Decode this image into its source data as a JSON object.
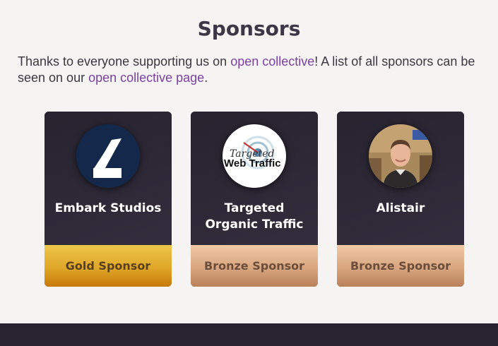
{
  "section": {
    "title": "Sponsors",
    "intro_before": "Thanks to everyone supporting us on ",
    "link1": "open collective",
    "intro_middle": "! A list of all sponsors can be seen on our ",
    "link2": "open collective page",
    "intro_end": "."
  },
  "sponsors": [
    {
      "name": "Embark Studios",
      "tier": "Gold Sponsor",
      "avatar": "embark-logo",
      "tier_color": "#e0a728"
    },
    {
      "name": "Targeted Organic Traffic",
      "tier": "Bronze Sponsor",
      "avatar": "targeted-web-traffic-logo",
      "logo_text_top": "Targeted",
      "logo_text_bottom": "Web Traffic",
      "tier_color": "#d8a680"
    },
    {
      "name": "Alistair",
      "tier": "Bronze Sponsor",
      "avatar": "person-photo",
      "tier_color": "#d8a680"
    }
  ]
}
